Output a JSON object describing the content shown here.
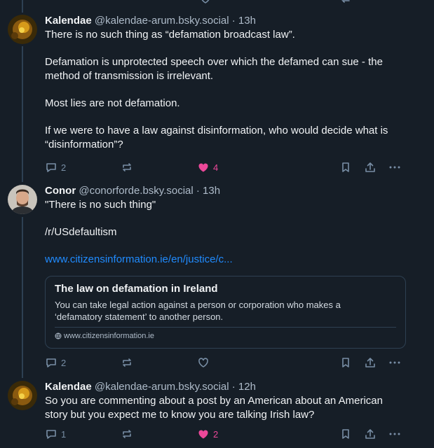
{
  "colors": {
    "background": "#161e27",
    "text": "#f1f3f5",
    "muted": "#788ea5",
    "link": "#208bfe",
    "like": "#ec4899"
  },
  "posts": [
    {
      "author": "Kalendae",
      "handle": "@kalendae-arum.bsky.social",
      "time": "· 13h",
      "paragraphs": [
        "There is no such thing as “defamation broadcast law”.",
        "Defamation is unprotected speech over which the defamed can sue - the method of transmission is irrelevant.",
        "Most lies are not defamation.",
        "If we were to have a law against disinformation, who would decide what is “disinformation”?"
      ],
      "replies": "2",
      "reposts": "",
      "likes": "4"
    },
    {
      "author": "Conor",
      "handle": "@conorforde.bsky.social",
      "time": "· 13h",
      "paragraphs": [
        "\"There is no such thing\"",
        "/r/USdefaultism"
      ],
      "link_text": "www.citizensinformation.ie/en/justice/c...",
      "card": {
        "title": "The law on defamation in Ireland",
        "description": "You can take legal action against a person or corporation who makes a ‘defamatory statement’ to another person.",
        "domain": "www.citizensinformation.ie"
      },
      "replies": "2",
      "reposts": "",
      "likes": ""
    },
    {
      "author": "Kalendae",
      "handle": "@kalendae-arum.bsky.social",
      "time": "· 12h",
      "paragraphs": [
        "So you are commenting about a post by an American about an American story but you expect me to know you are talking Irish law?"
      ],
      "replies": "1",
      "reposts": "",
      "likes": "2"
    }
  ]
}
